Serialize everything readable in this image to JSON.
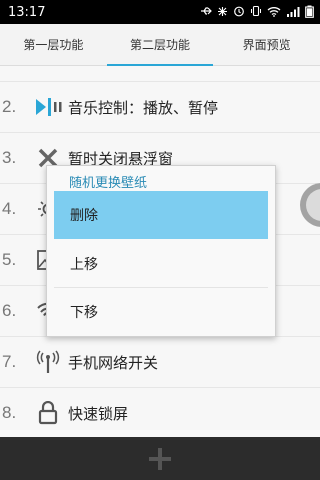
{
  "status_bar": {
    "time": "13:17",
    "icons": [
      "usb-icon",
      "debug-icon",
      "alarm-icon",
      "vibrate-icon",
      "wifi-icon",
      "signal-icon",
      "battery-icon"
    ]
  },
  "tabs": [
    {
      "label": "第一层功能",
      "active": false
    },
    {
      "label": "第二层功能",
      "active": true
    },
    {
      "label": "界面预览",
      "active": false
    }
  ],
  "list": {
    "items": [
      {
        "number": "2.",
        "icon": "music-control-icon",
        "label": "音乐控制：播放、暂停"
      },
      {
        "number": "3.",
        "icon": "close-x-icon",
        "label": "暂时关闭悬浮窗"
      },
      {
        "number": "4.",
        "icon": "brightness-icon",
        "label": ""
      },
      {
        "number": "5.",
        "icon": "image-icon",
        "label": ""
      },
      {
        "number": "6.",
        "icon": "wifi-icon",
        "label": ""
      },
      {
        "number": "7.",
        "icon": "antenna-icon",
        "label": "手机网络开关"
      },
      {
        "number": "8.",
        "icon": "lock-icon",
        "label": "快速锁屏"
      }
    ]
  },
  "popup": {
    "title": "随机更换壁纸",
    "items": [
      {
        "label": "删除",
        "selected": true
      },
      {
        "label": "上移",
        "selected": false
      },
      {
        "label": "下移",
        "selected": false
      }
    ]
  },
  "colors": {
    "accent": "#2aa6d6",
    "selected_item": "#7dcdf0",
    "popup_title": "#2a8bb5",
    "bottom_bar": "#2c2c2c"
  },
  "bottom_bar": {
    "icon": "plus-icon"
  }
}
